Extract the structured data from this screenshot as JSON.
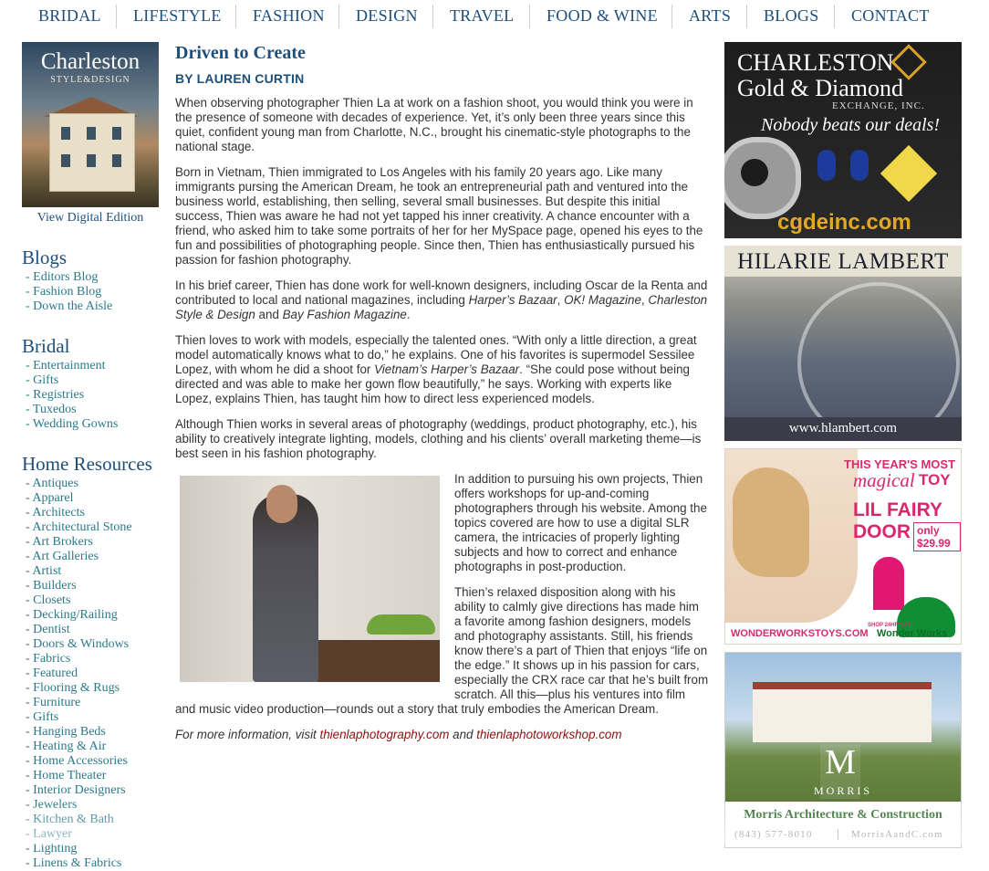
{
  "nav": [
    "BRIDAL",
    "LIFESTYLE",
    "FASHION",
    "DESIGN",
    "TRAVEL",
    "FOOD & WINE",
    "ARTS",
    "BLOGS",
    "CONTACT"
  ],
  "sidebar": {
    "cover_title": "Charleston",
    "cover_subtitle": "STYLE&DESIGN",
    "view_digital": "View Digital Edition",
    "blogs_title": "Blogs",
    "blogs": [
      "- Editors Blog",
      "- Fashion Blog",
      "- Down the Aisle"
    ],
    "bridal_title": "Bridal",
    "bridal": [
      "- Entertainment",
      "- Gifts",
      "- Registries",
      "- Tuxedos",
      "- Wedding Gowns"
    ],
    "home_title": "Home Resources",
    "home": [
      "- Antiques",
      "- Apparel",
      "- Architects",
      "- Architectural Stone",
      "- Art Brokers",
      "- Art Galleries",
      "- Artist",
      "- Builders",
      "- Closets",
      "- Decking/Railing",
      "- Dentist",
      "- Doors & Windows",
      "- Fabrics",
      "- Featured",
      "- Flooring & Rugs",
      "- Furniture",
      "- Gifts",
      "- Hanging Beds",
      "- Heating & Air",
      "- Home Accessories",
      "- Home Theater",
      "- Interior Designers",
      "- Jewelers",
      "- Kitchen & Bath",
      "- Lawyer",
      "- Lighting",
      "- Linens & Fabrics"
    ]
  },
  "article": {
    "title": "Driven to Create",
    "byline": "BY LAUREN CURTIN",
    "p1": "When observing photographer Thien La at work on a fashion shoot, you would think you were in the presence of someone with decades of experience. Yet, it’s only been three years since this quiet, confident young man from Charlotte, N.C., brought his cinematic-style photographs to the national stage.",
    "p2": "Born in Vietnam, Thien immigrated to Los Angeles with his family 20 years ago. Like many immigrants pursing the American Dream, he took an entrepreneurial path and ventured into the business world, establishing, then selling, several small businesses. But despite this initial success, Thien was aware he had not yet tapped his inner creativity. A chance encounter with a friend, who asked him to take some portraits of her for her MySpace page, opened his eyes to the fun and possibilities of photographing people. Since then, Thien has enthusiastically pursued his passion for fashion photography.",
    "p3a": "In his brief career, Thien has done work for well-known designers, including Oscar de la Renta and contributed to local and national magazines, including ",
    "p3_m1": "Harper’s Bazaar",
    "p3_c1": ", ",
    "p3_m2": "OK! Magazine",
    "p3_c2": ", ",
    "p3_m3": "Charleston Style & Design",
    "p3_and": " and ",
    "p3_m4": "Bay Fashion Magazine",
    "p3_end": ".",
    "p4a": "Thien loves to work with models, especially the talented ones. “With only a little direction, a great model automatically knows what to do,” he explains. One of his favorites is supermodel Sessilee Lopez, with whom he did a shoot for ",
    "p4_m": "Vietnam’s Harper’s Bazaar",
    "p4b": ". “She could pose without being directed and was able to make her gown flow beautifully,” he says. Working with experts like Lopez, explains Thien, has taught him how to direct less experienced models.",
    "p5": "Although Thien works in several areas of photography (weddings, product photography, etc.), his ability to creatively integrate lighting, models, clothing and his clients’ overall marketing theme—is best seen in his fashion photography.",
    "p6": "In addition to pursuing his own projects, Thien offers workshops for up-and-coming photographers through his website. Among the topics covered are how to use a digital SLR camera, the intricacies of properly lighting subjects and how to correct and enhance photographs in post-production.",
    "p7": "Thien’s relaxed disposition along with his ability to calmly give directions has made him a favorite among fashion designers, models and photography assistants. Still, his friends know there’s a part of Thien that enjoys “life on the edge.” It shows up in his passion for cars, especially the CRX race car that he’s built from scratch. All this—plus his ventures into film and music video production—rounds out a story that truly embodies the American Dream.",
    "more_a": "For more information, visit ",
    "more_link1": "thienlaphotography.com",
    "more_and": " and ",
    "more_link2": "thienlaphotoworkshop.com"
  },
  "ads": {
    "gold": {
      "line1": "CHARLESTON",
      "line2": "Gold & Diamond",
      "line3": "EXCHANGE, INC.",
      "tagline": "Nobody beats our deals!",
      "url": "cgdeinc.com"
    },
    "hilarie": {
      "name": "HILARIE LAMBERT",
      "url": "www.hlambert.com"
    },
    "fairy": {
      "line1": "THIS YEAR'S MOST",
      "magical": "magical",
      "toy": "TOY",
      "product": "LIL FAIRY DOOR",
      "price": "only $29.99",
      "shop": "SHOP 24HRS AT",
      "url": "WONDERWORKSTOYS.COM",
      "brand": "Wonder Works"
    },
    "morris": {
      "letter": "M",
      "label": "MORRIS",
      "name": "Morris Architecture & Construction",
      "phone": "(843) 577-8010",
      "url": "MorrisAandC.com"
    }
  },
  "colors": {
    "nav": "#1d4f7a",
    "link": "#8b1010",
    "sidebar_link": "#2a7a8a"
  }
}
